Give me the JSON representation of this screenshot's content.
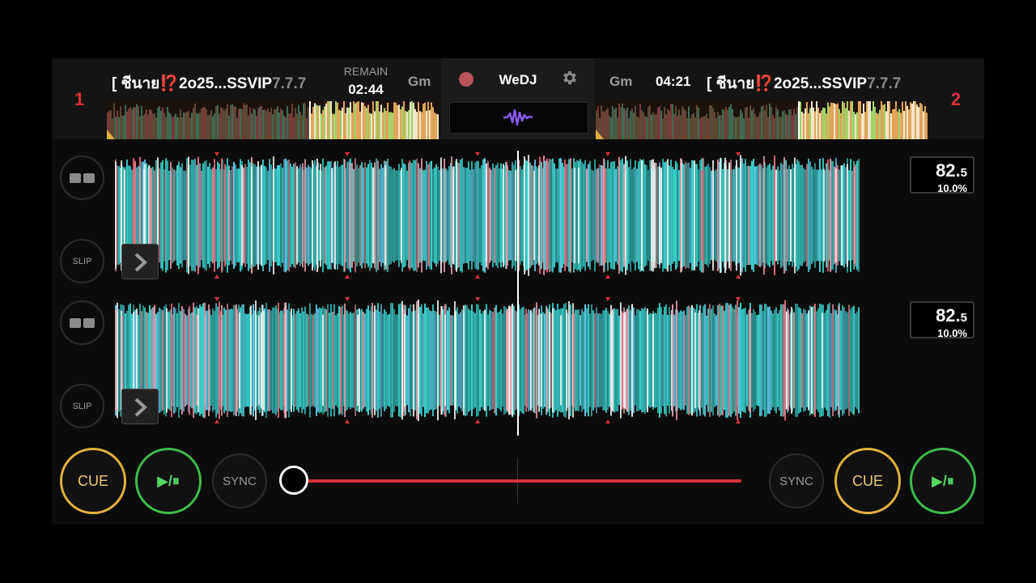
{
  "app": {
    "brand": "WeDJ"
  },
  "deck1": {
    "number": "1",
    "title_main": "[ ชีนาย⁉️2o25...SSVIP",
    "title_dim": "7.7.7",
    "remain_label": "REMAIN",
    "remain_time": "02:44",
    "key": "Gm",
    "played_fraction": 0.61
  },
  "deck2": {
    "number": "2",
    "title_main": "[ ชีนาย⁉️2o25...SSVIP",
    "title_dim": "7.7.7",
    "time": "04:21",
    "key": "Gm",
    "played_fraction": 0.61
  },
  "waveforms": [
    {
      "bpm_int": "82.",
      "bpm_frac": "5",
      "pitch": "10.0%",
      "slip_label": "SLIP"
    },
    {
      "bpm_int": "82.",
      "bpm_frac": "5",
      "pitch": "10.0%",
      "slip_label": "SLIP"
    }
  ],
  "transport": {
    "cue_label": "CUE",
    "play_label": "▶/⏸",
    "sync_label": "SYNC",
    "crossfader_position": 0.0
  },
  "colors": {
    "accent_red": "#d8313a",
    "cue_yellow": "#e3b23c",
    "play_green": "#3dbd4a",
    "wave_cyan": "#3ee6e0",
    "wave_pink": "#e89aa8"
  },
  "icons": {
    "record": "record-icon",
    "settings": "gear-icon",
    "waveform": "waveform-icon",
    "expand": "chevron-right-icon",
    "split": "split-view-icon"
  }
}
